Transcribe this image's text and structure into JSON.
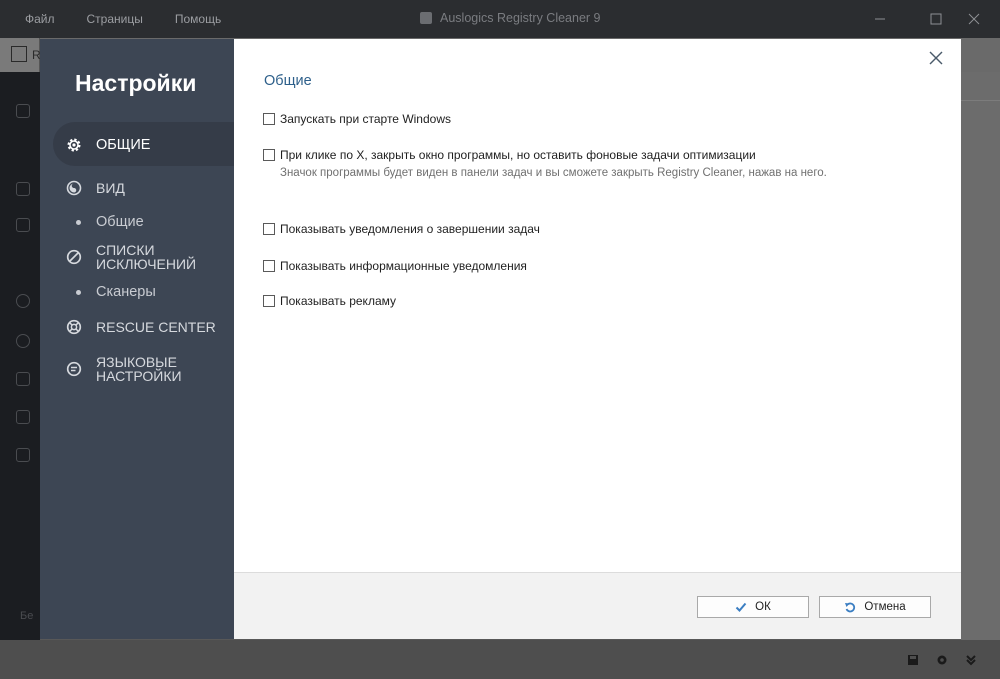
{
  "app": {
    "menu": [
      "Файл",
      "Страницы",
      "Помощь"
    ],
    "title": "Auslogics Registry Cleaner 9",
    "bg_tab_label": "R",
    "bg_left_label": "Бе"
  },
  "dialog": {
    "title": "Настройки",
    "nav": [
      {
        "label": "ОБЩИЕ",
        "icon": "gear-icon",
        "active": true
      },
      {
        "label": "ВИД",
        "icon": "palette-icon"
      },
      {
        "label": "Общие",
        "sub": true
      },
      {
        "label_line1": "СПИСКИ",
        "label_line2": "ИСКЛЮЧЕНИЙ",
        "icon": "block-icon"
      },
      {
        "label": "Сканеры",
        "sub": true
      },
      {
        "label": "RESCUE CENTER",
        "icon": "lifebuoy-icon"
      },
      {
        "label_line1": "ЯЗЫКОВЫЕ",
        "label_line2": "НАСТРОЙКИ",
        "icon": "language-icon"
      }
    ],
    "section_title": "Общие",
    "options": [
      {
        "label": "Запускать при старте Windows",
        "checked": false
      },
      {
        "label": "При клике по X, закрыть окно программы, но оставить фоновые задачи оптимизации",
        "checked": false,
        "description": "Значок программы будет виден в панели задач и вы сможете закрыть Registry Cleaner, нажав на него."
      },
      {
        "label": "Показывать уведомления о завершении задач",
        "checked": false
      },
      {
        "label": "Показывать информационные уведомления",
        "checked": false
      },
      {
        "label": "Показывать рекламу",
        "checked": false
      }
    ],
    "ok_label": "ОК",
    "cancel_label": "Отмена"
  },
  "colors": {
    "sidebar": "#3d4654",
    "sidebar_active": "#353c48",
    "accent_title": "#2d5f8a",
    "ok_check": "#3b7ec2"
  }
}
